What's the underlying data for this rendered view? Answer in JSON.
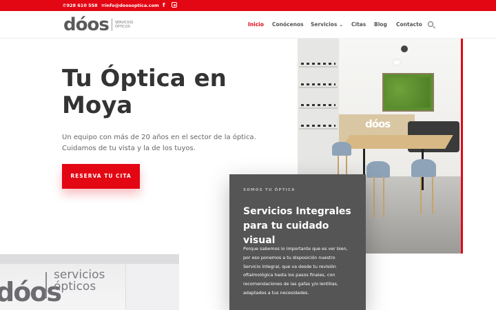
{
  "topbar": {
    "phone": "928 610 558",
    "email": "info@doosoptica.com",
    "icons": [
      "phone-icon",
      "mail-icon",
      "facebook-icon",
      "instagram-icon"
    ]
  },
  "header": {
    "logo_text": "dóos",
    "logo_sub_line1": "SERVICIOS",
    "logo_sub_line2": "ÓPTICOS",
    "nav": [
      {
        "label": "Inicio",
        "active": true
      },
      {
        "label": "Conócenos",
        "active": false
      },
      {
        "label": "Servicios",
        "active": false
      },
      {
        "label": "Citas",
        "active": false
      },
      {
        "label": "Blog",
        "active": false
      },
      {
        "label": "Contacto",
        "active": false
      }
    ],
    "servicios_chevron": "⌄"
  },
  "hero": {
    "title": "Tu Óptica en Moya",
    "text": "Un equipo con más de 20 años en el sector de la óptica. Cuidamos de tu vista y la de los tuyos.",
    "cta_label": "RESERVA TU CITA"
  },
  "photo": {
    "counter_logo": "dóos"
  },
  "card": {
    "kicker": "SOMOS TU ÓPTICA",
    "title": "Servicios Integrales para tu cuidado visual",
    "text": "Porque sabemos lo importante que es ver bien, por eso ponemos a tu disposición nuestro Servicio Integral, que va desde tu revisión oftalmológica hasta los pasos finales, con recomendaciones de las gafas y/o lentillas, adaptados a tus necesidades."
  },
  "facade": {
    "logo": "dóos",
    "sub_line1": "servicios",
    "sub_line2": "ópticos"
  },
  "colors": {
    "brand_red": "#e30613",
    "card_grey": "#555556",
    "text_dark": "#333333"
  }
}
